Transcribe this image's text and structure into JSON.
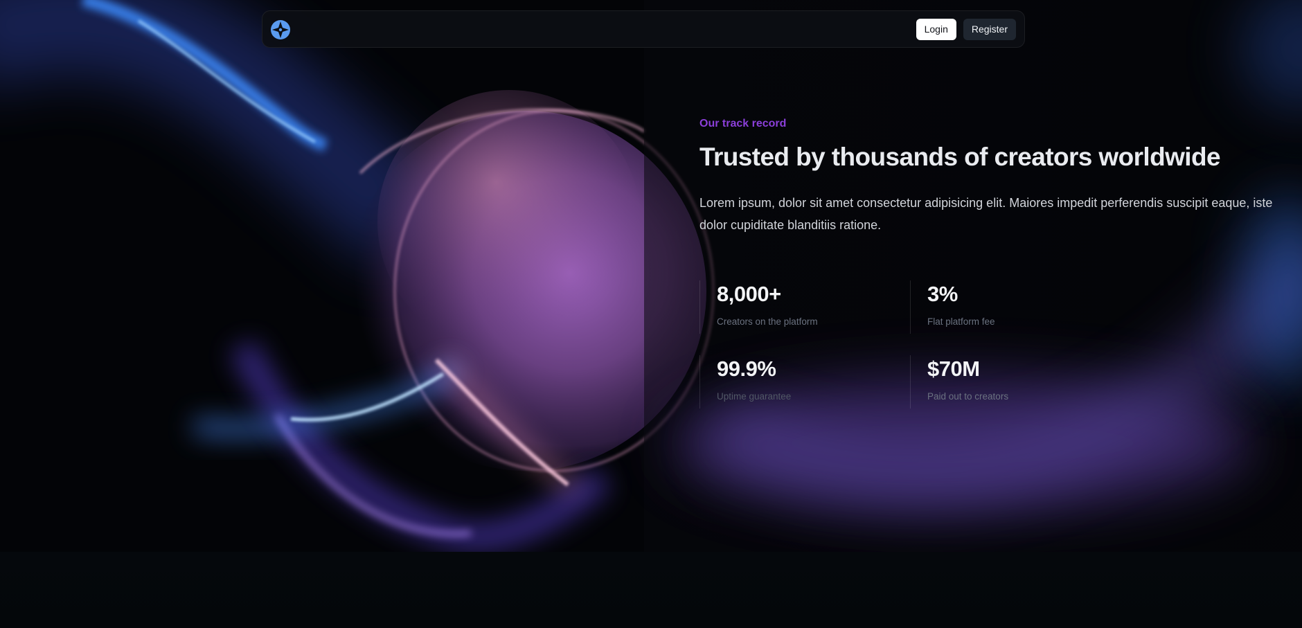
{
  "nav": {
    "logo_icon": "compass-logo-icon",
    "login_label": "Login",
    "register_label": "Register"
  },
  "hero": {
    "eyebrow": "Our track record",
    "title": "Trusted by thousands of creators worldwide",
    "description": "Lorem ipsum, dolor sit amet consectetur adipisicing elit. Maiores impedit perferendis suscipit eaque, iste dolor cupiditate blanditiis ratione."
  },
  "stats": [
    {
      "value": "8,000+",
      "label": "Creators on the platform"
    },
    {
      "value": "3%",
      "label": "Flat platform fee"
    },
    {
      "value": "99.9%",
      "label": "Uptime guarantee"
    },
    {
      "value": "$70M",
      "label": "Paid out to creators"
    }
  ],
  "colors": {
    "accent": "#8b3fd9",
    "background": "#030407",
    "logo": "#5a9bf0"
  }
}
